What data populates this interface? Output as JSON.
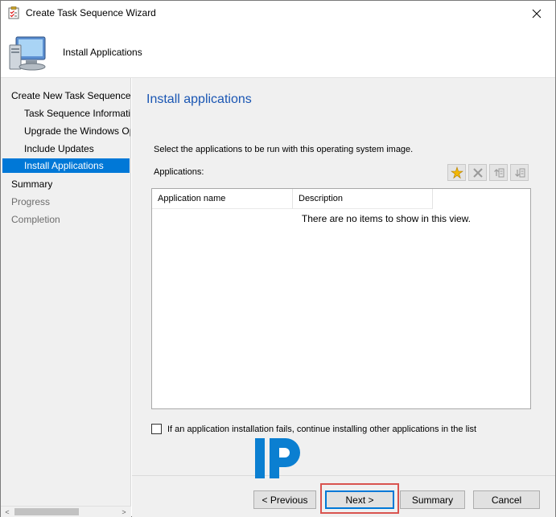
{
  "window": {
    "title": "Create Task Sequence Wizard",
    "close_glyph": "✕"
  },
  "header": {
    "title": "Install Applications"
  },
  "nav": {
    "items": [
      {
        "label": "Create New Task Sequence",
        "level": "group",
        "state": "normal"
      },
      {
        "label": "Task Sequence Information",
        "level": "sub",
        "state": "normal"
      },
      {
        "label": "Upgrade the Windows Operating System",
        "level": "sub",
        "state": "normal"
      },
      {
        "label": "Include Updates",
        "level": "sub",
        "state": "normal"
      },
      {
        "label": "Install Applications",
        "level": "sub",
        "state": "selected"
      },
      {
        "label": "Summary",
        "level": "group",
        "state": "normal"
      },
      {
        "label": "Progress",
        "level": "group",
        "state": "disabled"
      },
      {
        "label": "Completion",
        "level": "group",
        "state": "disabled"
      }
    ],
    "scroll_left": "<",
    "scroll_right": ">"
  },
  "content": {
    "page_title": "Install applications",
    "instruction": "Select the applications to be run with this operating system image.",
    "apps_label": "Applications:",
    "toolbar": [
      "new-icon",
      "delete-icon",
      "move-up-icon",
      "move-down-icon"
    ],
    "list": {
      "columns": [
        "Application name",
        "Description"
      ],
      "empty_message": "There are no items to show in this view."
    },
    "checkbox": {
      "label": "If an application installation fails, continue installing other applications in the list",
      "checked": false
    }
  },
  "footer": {
    "previous": "< Previous",
    "next": "Next >",
    "summary": "Summary",
    "cancel": "Cancel"
  },
  "colors": {
    "accent": "#0078d7",
    "title_blue": "#1a56b3",
    "highlight_red": "#d9534f"
  }
}
